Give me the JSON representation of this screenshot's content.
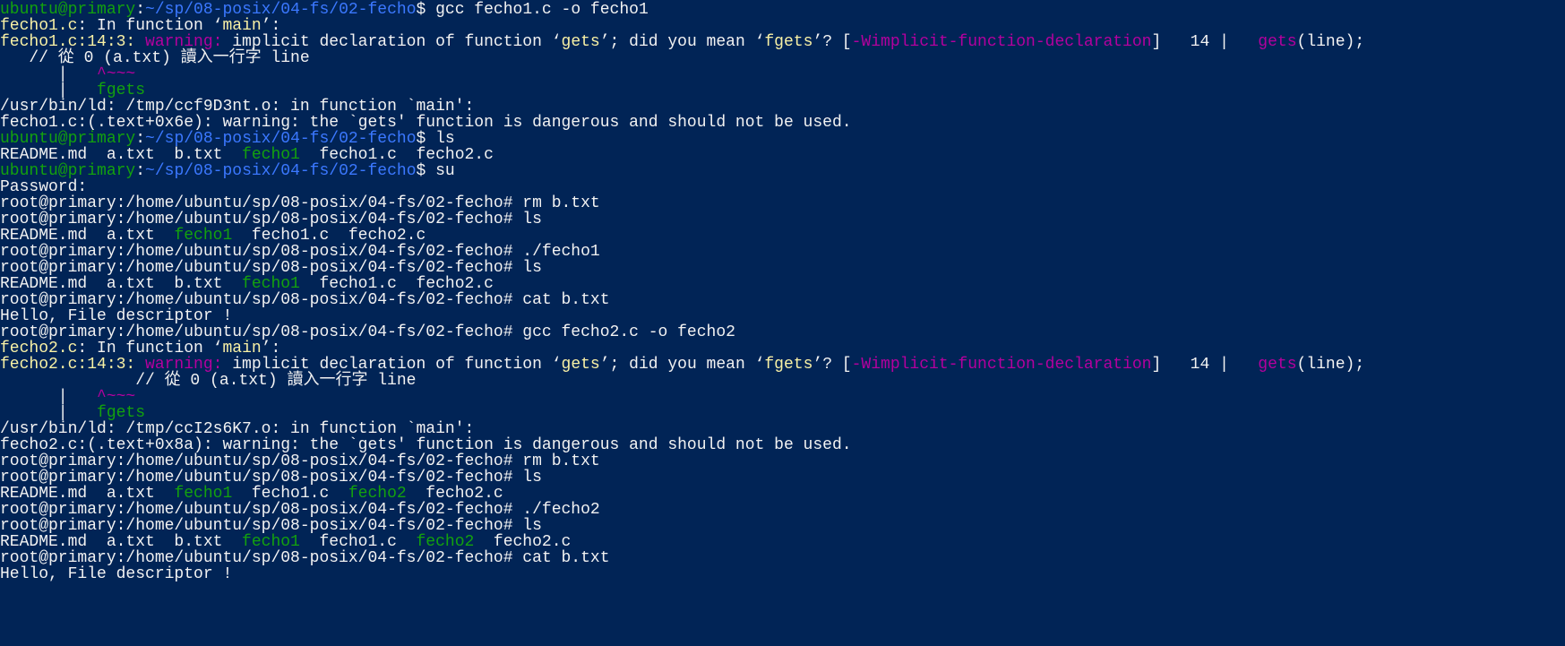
{
  "colors": {
    "background": "#012456",
    "foreground": "#eeedf0",
    "prompt_user": "#13a10e",
    "prompt_path": "#3b78ff",
    "file": "#f9f1a5",
    "warning": "#b4009e",
    "executable": "#13a10e"
  },
  "lines": [
    [
      [
        "g",
        "ubuntu@primary"
      ],
      [
        "w",
        ":"
      ],
      [
        "b",
        "~/sp/08-posix/04-fs/02-fecho"
      ],
      [
        "w",
        "$ gcc fecho1.c -o fecho1"
      ]
    ],
    [
      [
        "y",
        "fecho1.c"
      ],
      [
        "w",
        ": In function "
      ],
      [
        "w",
        "‘"
      ],
      [
        "y",
        "main"
      ],
      [
        "w",
        "’:"
      ]
    ],
    [
      [
        "y",
        "fecho1.c:14:3: "
      ],
      [
        "m",
        "warning: "
      ],
      [
        "w",
        "implicit declaration of function ‘"
      ],
      [
        "y",
        "gets"
      ],
      [
        "w",
        "’; did you mean ‘"
      ],
      [
        "y",
        "fgets"
      ],
      [
        "w",
        "’? ["
      ],
      [
        "m",
        "-Wimplicit-function-declaration"
      ],
      [
        "w",
        "]   14 |   "
      ],
      [
        "m",
        "gets"
      ],
      [
        "w",
        "(line);"
      ]
    ],
    [
      [
        "w",
        "   // 從 0 (a.txt) 讀入一行字 line"
      ]
    ],
    [
      [
        "w",
        "      |   "
      ],
      [
        "m",
        "^~~~"
      ]
    ],
    [
      [
        "w",
        "      |   "
      ],
      [
        "g",
        "fgets"
      ]
    ],
    [
      [
        "w",
        "/usr/bin/ld: /tmp/ccf9D3nt.o: in function `main':"
      ]
    ],
    [
      [
        "w",
        "fecho1.c:(.text+0x6e): warning: the `gets' function is dangerous and should not be used."
      ]
    ],
    [
      [
        "g",
        "ubuntu@primary"
      ],
      [
        "w",
        ":"
      ],
      [
        "b",
        "~/sp/08-posix/04-fs/02-fecho"
      ],
      [
        "w",
        "$ ls"
      ]
    ],
    [
      [
        "w",
        "README.md  a.txt  b.txt  "
      ],
      [
        "g",
        "fecho1"
      ],
      [
        "w",
        "  fecho1.c  fecho2.c"
      ]
    ],
    [
      [
        "g",
        "ubuntu@primary"
      ],
      [
        "w",
        ":"
      ],
      [
        "b",
        "~/sp/08-posix/04-fs/02-fecho"
      ],
      [
        "w",
        "$ su"
      ]
    ],
    [
      [
        "w",
        "Password:"
      ]
    ],
    [
      [
        "w",
        "root@primary:/home/ubuntu/sp/08-posix/04-fs/02-fecho# rm b.txt"
      ]
    ],
    [
      [
        "w",
        "root@primary:/home/ubuntu/sp/08-posix/04-fs/02-fecho# ls"
      ]
    ],
    [
      [
        "w",
        "README.md  a.txt  "
      ],
      [
        "g",
        "fecho1"
      ],
      [
        "w",
        "  fecho1.c  fecho2.c"
      ]
    ],
    [
      [
        "w",
        "root@primary:/home/ubuntu/sp/08-posix/04-fs/02-fecho# ./fecho1"
      ]
    ],
    [
      [
        "w",
        "root@primary:/home/ubuntu/sp/08-posix/04-fs/02-fecho# ls"
      ]
    ],
    [
      [
        "w",
        "README.md  a.txt  b.txt  "
      ],
      [
        "g",
        "fecho1"
      ],
      [
        "w",
        "  fecho1.c  fecho2.c"
      ]
    ],
    [
      [
        "w",
        "root@primary:/home/ubuntu/sp/08-posix/04-fs/02-fecho# cat b.txt"
      ]
    ],
    [
      [
        "w",
        "Hello, File descriptor !"
      ]
    ],
    [
      [
        "w",
        "root@primary:/home/ubuntu/sp/08-posix/04-fs/02-fecho# gcc fecho2.c -o fecho2"
      ]
    ],
    [
      [
        "y",
        "fecho2.c"
      ],
      [
        "w",
        ": In function "
      ],
      [
        "w",
        "‘"
      ],
      [
        "y",
        "main"
      ],
      [
        "w",
        "’:"
      ]
    ],
    [
      [
        "y",
        "fecho2.c:14:3: "
      ],
      [
        "m",
        "warning: "
      ],
      [
        "w",
        "implicit declaration of function ‘"
      ],
      [
        "y",
        "gets"
      ],
      [
        "w",
        "’; did you mean ‘"
      ],
      [
        "y",
        "fgets"
      ],
      [
        "w",
        "’? ["
      ],
      [
        "m",
        "-Wimplicit-function-declaration"
      ],
      [
        "w",
        "]   14 |   "
      ],
      [
        "m",
        "gets"
      ],
      [
        "w",
        "(line);"
      ]
    ],
    [
      [
        "w",
        "              // 從 0 (a.txt) 讀入一行字 line"
      ]
    ],
    [
      [
        "w",
        "      |   "
      ],
      [
        "m",
        "^~~~"
      ]
    ],
    [
      [
        "w",
        "      |   "
      ],
      [
        "g",
        "fgets"
      ]
    ],
    [
      [
        "w",
        "/usr/bin/ld: /tmp/ccI2s6K7.o: in function `main':"
      ]
    ],
    [
      [
        "w",
        "fecho2.c:(.text+0x8a): warning: the `gets' function is dangerous and should not be used."
      ]
    ],
    [
      [
        "w",
        "root@primary:/home/ubuntu/sp/08-posix/04-fs/02-fecho# rm b.txt"
      ]
    ],
    [
      [
        "w",
        "root@primary:/home/ubuntu/sp/08-posix/04-fs/02-fecho# ls"
      ]
    ],
    [
      [
        "w",
        "README.md  a.txt  "
      ],
      [
        "g",
        "fecho1"
      ],
      [
        "w",
        "  fecho1.c  "
      ],
      [
        "g",
        "fecho2"
      ],
      [
        "w",
        "  fecho2.c"
      ]
    ],
    [
      [
        "w",
        "root@primary:/home/ubuntu/sp/08-posix/04-fs/02-fecho# ./fecho2"
      ]
    ],
    [
      [
        "w",
        "root@primary:/home/ubuntu/sp/08-posix/04-fs/02-fecho# ls"
      ]
    ],
    [
      [
        "w",
        "README.md  a.txt  b.txt  "
      ],
      [
        "g",
        "fecho1"
      ],
      [
        "w",
        "  fecho1.c  "
      ],
      [
        "g",
        "fecho2"
      ],
      [
        "w",
        "  fecho2.c"
      ]
    ],
    [
      [
        "w",
        "root@primary:/home/ubuntu/sp/08-posix/04-fs/02-fecho# cat b.txt"
      ]
    ],
    [
      [
        "w",
        "Hello, File descriptor !"
      ]
    ]
  ]
}
